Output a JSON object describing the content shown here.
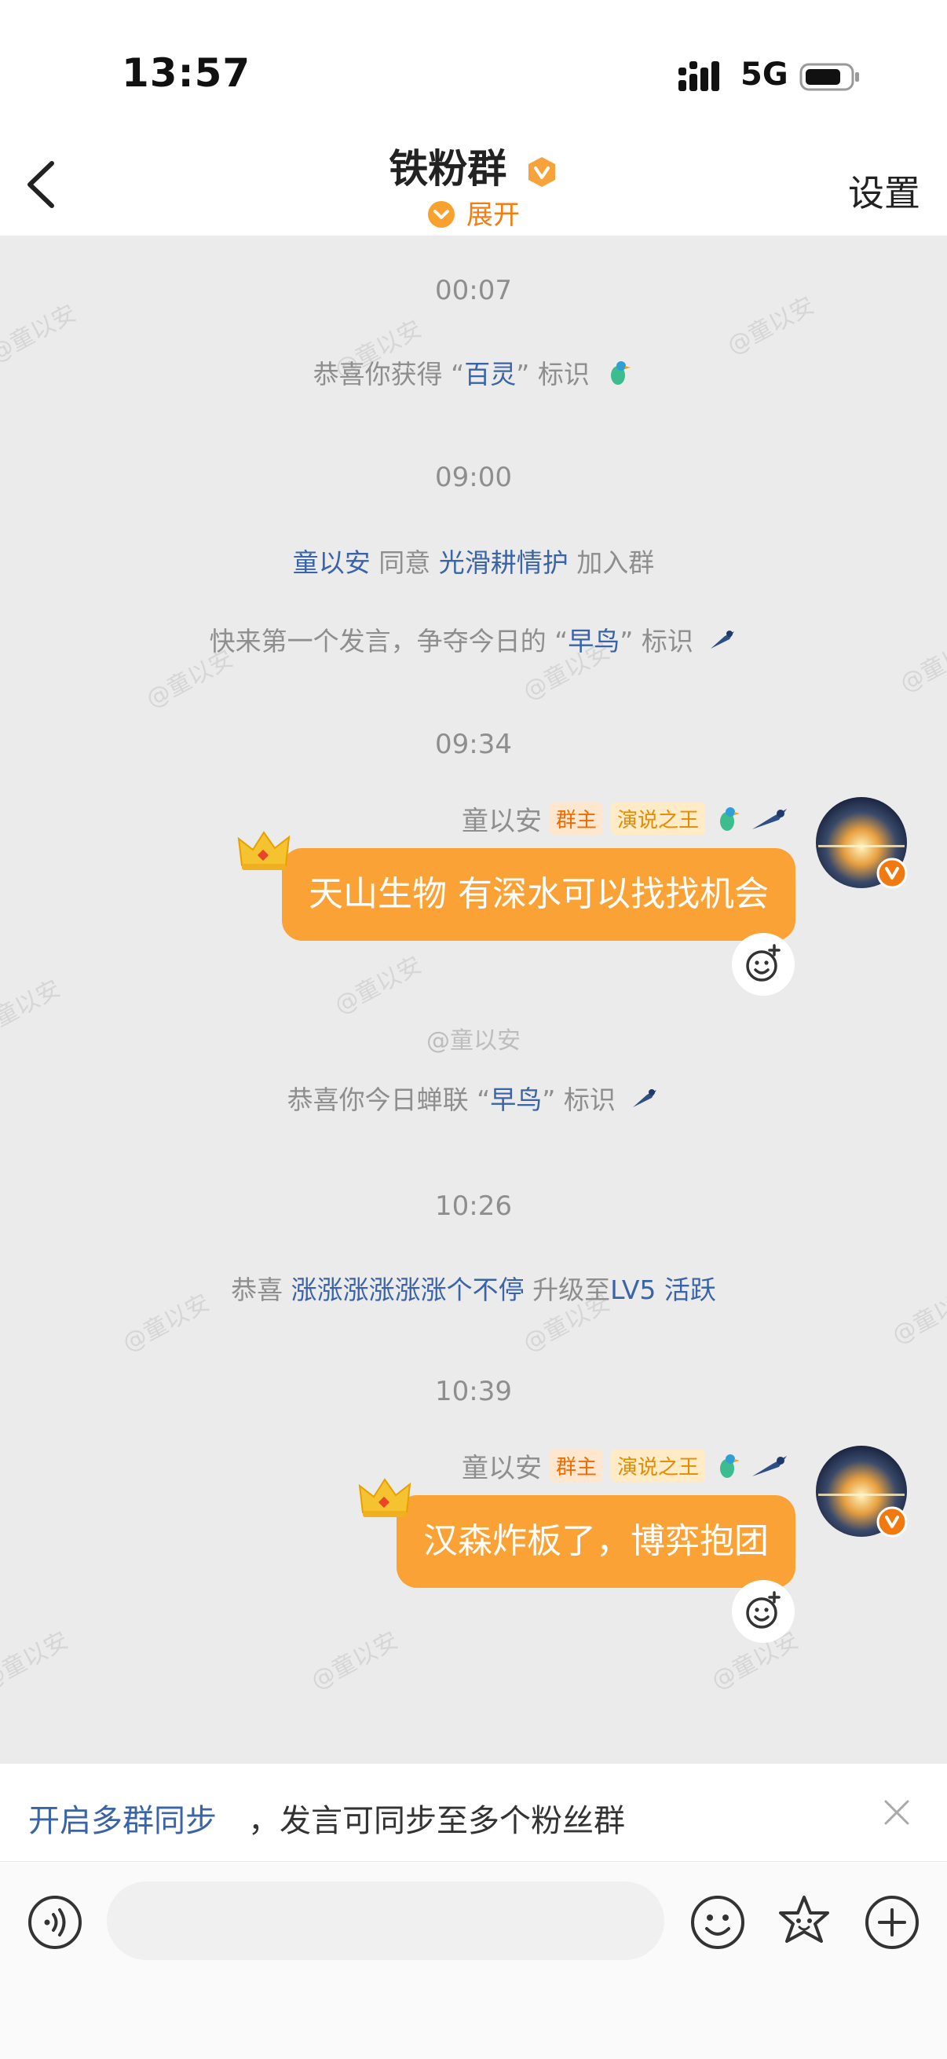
{
  "status_bar": {
    "time": "13:57",
    "network": "5G"
  },
  "header": {
    "title": "铁粉群",
    "expand_label": "展开",
    "settings_label": "设置"
  },
  "watermark": "@童以安",
  "chat": {
    "timestamps": [
      "00:07",
      "09:00",
      "09:34",
      "10:26",
      "10:39"
    ],
    "system": {
      "s1": {
        "pre": "恭喜你获得 “",
        "highlight": "百灵",
        "post": "” 标识"
      },
      "s2": {
        "user": "童以安",
        "mid": "同意",
        "target": "光滑耕情护",
        "post": "加入群"
      },
      "s3": {
        "pre": "快来第一个发言，争夺今日的 “",
        "highlight": "早鸟",
        "post": "” 标识"
      },
      "s4": {
        "pre": "恭喜你今日蝉联 “",
        "highlight": "早鸟",
        "post": "” 标识"
      },
      "s5": {
        "pre": "恭喜",
        "user": "涨涨涨涨涨涨个不停",
        "mid": "升级至",
        "level": "LV5 活跃"
      }
    },
    "messages": [
      {
        "sender": "童以安",
        "badge_host": "群主",
        "badge_title": "演说之王",
        "text": "天山生物 有深水可以找找机会"
      },
      {
        "sender": "童以安",
        "badge_host": "群主",
        "badge_title": "演说之王",
        "text": "汉森炸板了，博弈抱团"
      }
    ]
  },
  "sync_bar": {
    "link": "开启多群同步",
    "text": "，发言可同步至多个粉丝群"
  },
  "input": {
    "placeholder": ""
  },
  "colors": {
    "accent": "#fba236",
    "link": "#3a64a7",
    "chat_bg": "#ebebeb"
  },
  "icons": [
    "back-icon",
    "verified-icon",
    "chevron-down-icon",
    "voice-icon",
    "emoji-icon",
    "sticker-icon",
    "plus-icon",
    "close-icon",
    "add-reaction-icon",
    "crown-icon",
    "bird-icon"
  ]
}
